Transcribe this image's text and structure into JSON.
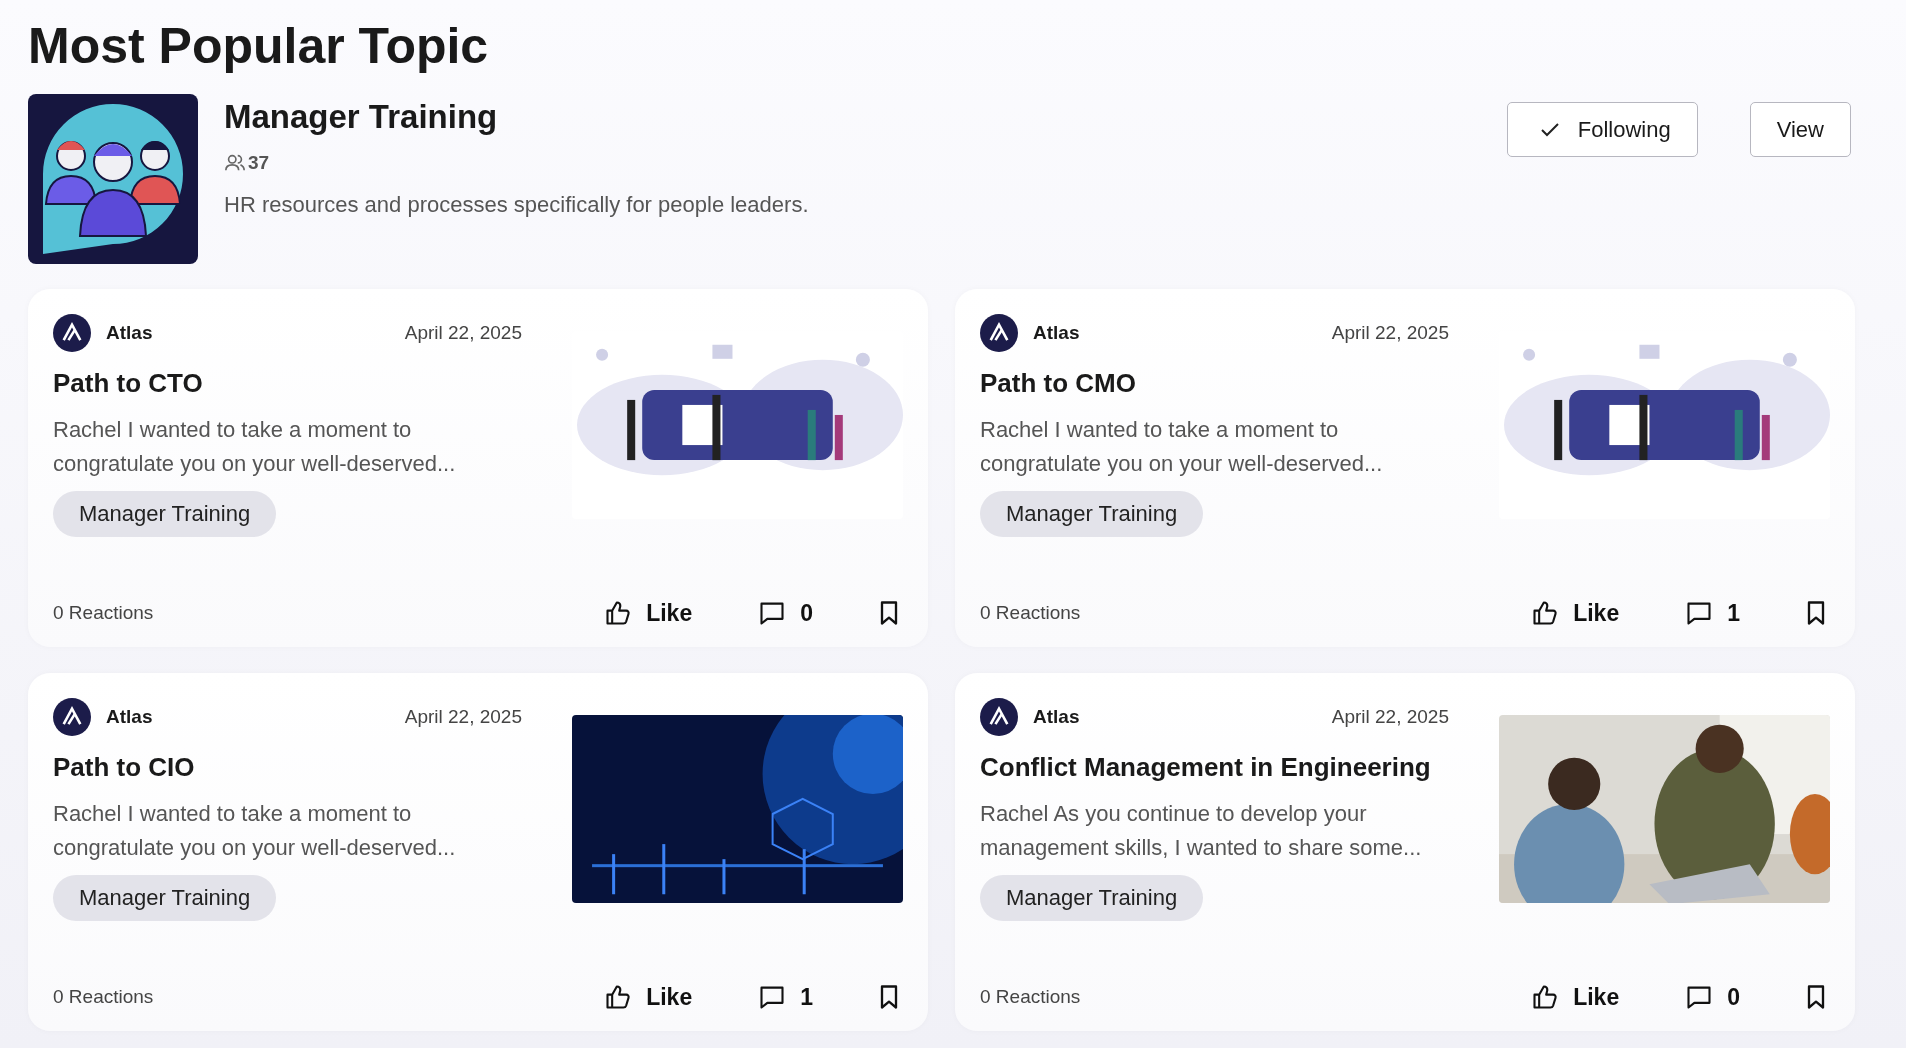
{
  "heading": "Most Popular Topic",
  "topic": {
    "name": "Manager Training",
    "members": "37",
    "description": "HR resources and processes specifically for people leaders.",
    "following": true,
    "follow_label": "Following",
    "view_label": "View"
  },
  "posts": [
    {
      "author": "Atlas",
      "date": "April 22, 2025",
      "title": "Path to CTO",
      "excerpt": "Rachel I wanted to take a moment to congratulate you on your well-deserved...",
      "tag": "Manager Training",
      "reactions": "0 Reactions",
      "like_label": "Like",
      "comments": "0"
    },
    {
      "author": "Atlas",
      "date": "April 22, 2025",
      "title": "Path to CMO",
      "excerpt": "Rachel I wanted to take a moment to congratulate you on your well-deserved...",
      "tag": "Manager Training",
      "reactions": "0 Reactions",
      "like_label": "Like",
      "comments": "1"
    },
    {
      "author": "Atlas",
      "date": "April 22, 2025",
      "title": "Path to CIO",
      "excerpt": "Rachel I wanted to take a moment to congratulate you on your well-deserved...",
      "tag": "Manager Training",
      "reactions": "0 Reactions",
      "like_label": "Like",
      "comments": "1"
    },
    {
      "author": "Atlas",
      "date": "April 22, 2025",
      "title": "Conflict Management in Engineering",
      "excerpt": "Rachel As you continue to develop your management skills, I wanted to share some...",
      "tag": "Manager Training",
      "reactions": "0 Reactions",
      "like_label": "Like",
      "comments": "0"
    }
  ]
}
